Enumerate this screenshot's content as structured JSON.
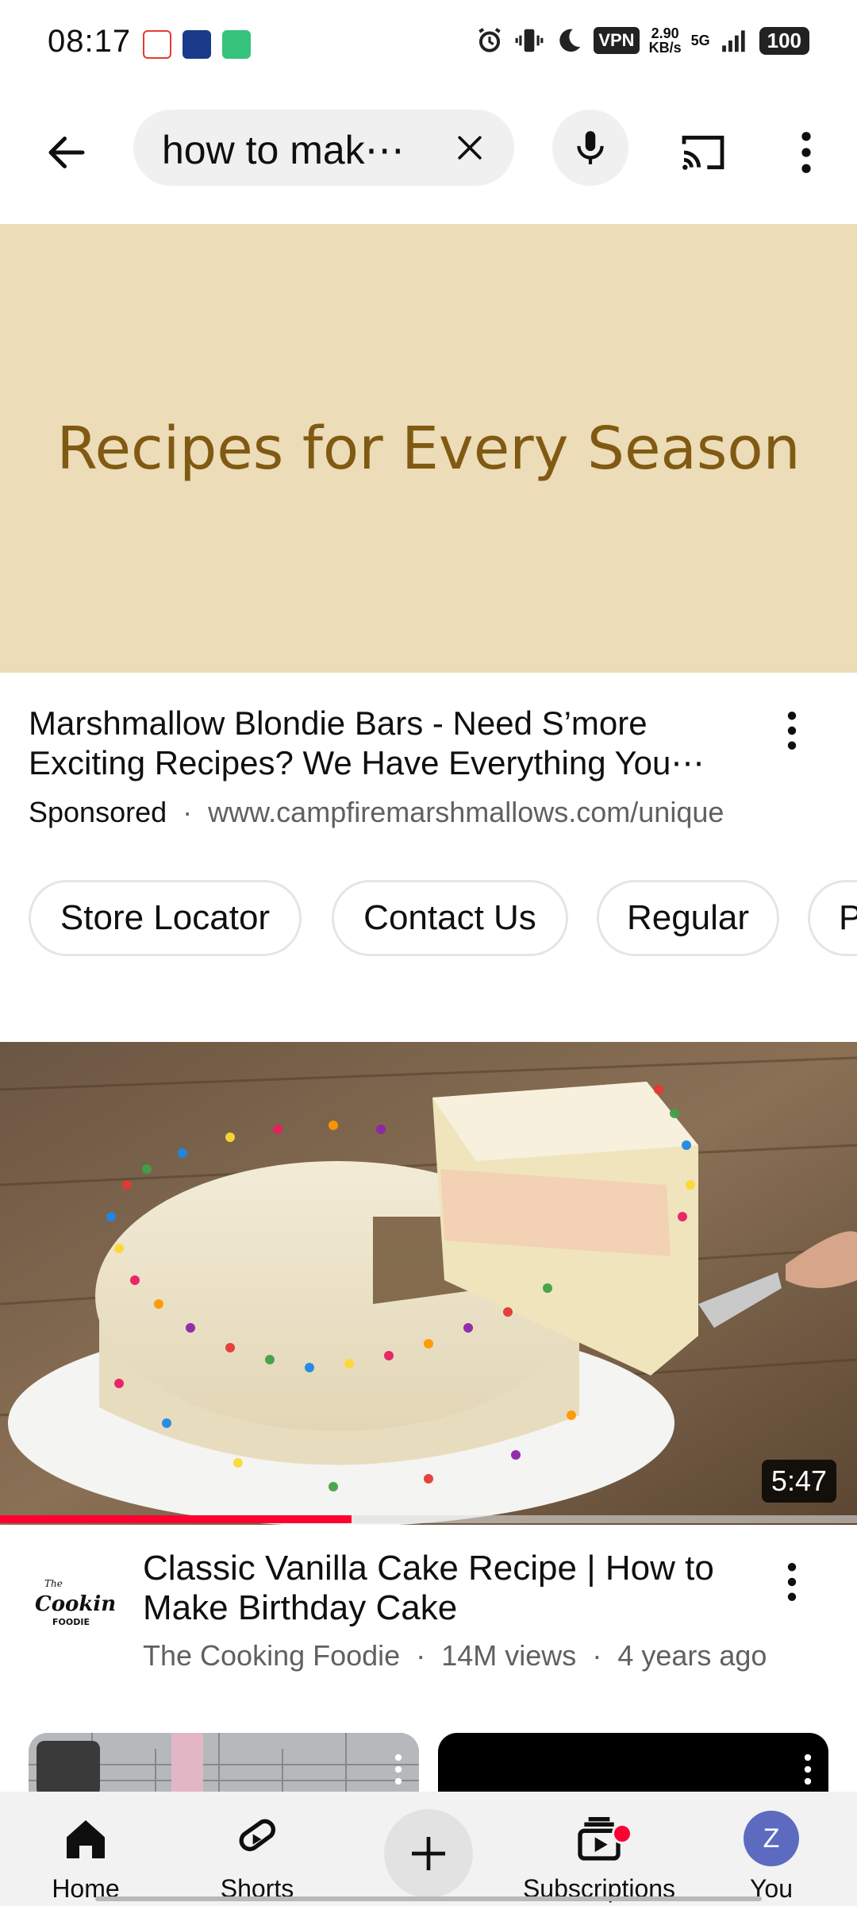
{
  "status_bar": {
    "time": "08:17",
    "vpn": "VPN",
    "speed_value": "2.90",
    "speed_unit": "KB/s",
    "network": "5G",
    "battery": "100"
  },
  "search": {
    "query": "how to mak⋯"
  },
  "ad": {
    "banner_text": "Recipes for Every Season",
    "banner_bg": "#ecdcb7",
    "banner_text_color": "#805a13",
    "title": "Marshmallow Blondie Bars - Need S’more Exciting Recipes? We Have Everything You⋯",
    "sponsored_label": "Sponsored",
    "separator": "·",
    "url": "www.campfiremarshmallows.com/unique",
    "chips": [
      "Store Locator",
      "Contact Us",
      "Regular",
      "P"
    ]
  },
  "video": {
    "duration": "5:47",
    "progress_fraction": 0.41,
    "title": "Classic Vanilla Cake Recipe | How to Make Birthday Cake",
    "channel": "The Cooking Foodie",
    "separator": "·",
    "views": "14M views",
    "age": "4 years ago",
    "channel_logo_text": "Cooking",
    "channel_logo_sub": "FOODIE",
    "channel_logo_the": "The"
  },
  "bottom_nav": {
    "home": "Home",
    "shorts": "Shorts",
    "subscriptions": "Subscriptions",
    "you": "You",
    "you_initial": "Z"
  },
  "colors": {
    "accent_red": "#ff0033",
    "you_avatar": "#5c6bc0"
  }
}
